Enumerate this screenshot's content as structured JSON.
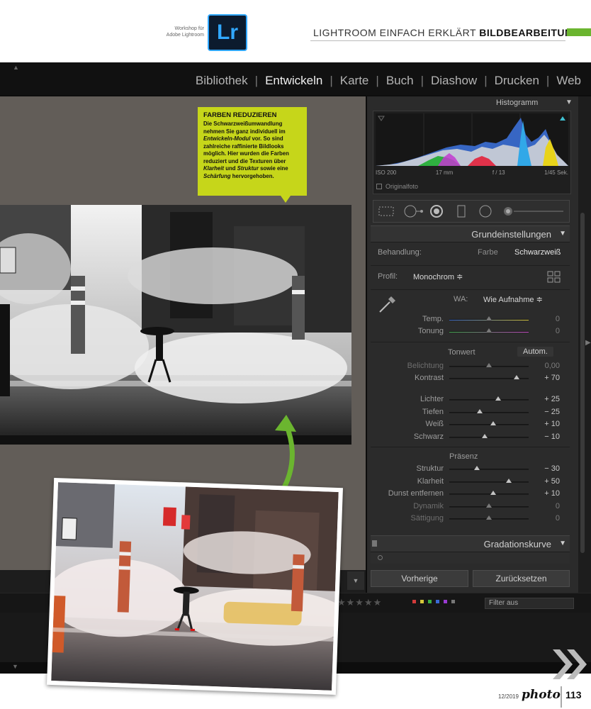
{
  "magazine": {
    "workshop_line1": "Workshop für",
    "workshop_line2": "Adobe Lightroom",
    "logo_text": "Lr",
    "header_normal": "LIGHTROOM EINFACH ERKLÄRT",
    "header_bold": "BILDBEARBEITUNG",
    "footer_issue": "12/2019",
    "footer_brand": "photo",
    "footer_page": "113"
  },
  "modules": {
    "items": [
      "Bibliothek",
      "Entwickeln",
      "Karte",
      "Buch",
      "Diashow",
      "Drucken",
      "Web"
    ],
    "active": "Entwickeln"
  },
  "histogram": {
    "title": "Histogramm",
    "iso": "ISO 200",
    "focal": "17 mm",
    "aperture": "f / 13",
    "shutter": "1/45 Sek.",
    "original_photo": "Originalfoto"
  },
  "basic": {
    "title": "Grundeinstellungen",
    "treatment_label": "Behandlung:",
    "treatment_color": "Farbe",
    "treatment_bw": "Schwarzweiß",
    "profile_label": "Profil:",
    "profile_value": "Monochrom ≑",
    "wb_label": "WA:",
    "wb_value": "Wie Aufnahme ≑",
    "temp_label": "Temp.",
    "temp_value": "0",
    "tint_label": "Tonung",
    "tint_value": "0",
    "tone_label": "Tonwert",
    "auto_label": "Autom.",
    "sliders_tone": [
      {
        "label": "Belichtung",
        "value": "0,00",
        "pos": 0.5,
        "dim": true
      },
      {
        "label": "Kontrast",
        "value": "+ 70",
        "pos": 0.85,
        "dim": false
      }
    ],
    "sliders_light": [
      {
        "label": "Lichter",
        "value": "+ 25",
        "pos": 0.62
      },
      {
        "label": "Tiefen",
        "value": "− 25",
        "pos": 0.38
      },
      {
        "label": "Weiß",
        "value": "+ 10",
        "pos": 0.55
      },
      {
        "label": "Schwarz",
        "value": "− 10",
        "pos": 0.45
      }
    ],
    "presence_label": "Präsenz",
    "sliders_presence": [
      {
        "label": "Struktur",
        "value": "− 30",
        "pos": 0.35,
        "dim": false
      },
      {
        "label": "Klarheit",
        "value": "+ 50",
        "pos": 0.75,
        "dim": false
      },
      {
        "label": "Dunst entfernen",
        "value": "+ 10",
        "pos": 0.55,
        "dim": false
      },
      {
        "label": "Dynamik",
        "value": "0",
        "pos": 0.5,
        "dim": true
      },
      {
        "label": "Sättigung",
        "value": "0",
        "pos": 0.5,
        "dim": true
      }
    ]
  },
  "curve": {
    "title": "Gradationskurve"
  },
  "buttons": {
    "previous": "Vorherige",
    "reset": "Zurücksetzen"
  },
  "filmstrip": {
    "filter": "Filter aus"
  },
  "callout": {
    "title": "FARBEN REDUZIEREN",
    "text_1": "Die Schwarzweißumwandlung nehmen Sie ganz individuell im ",
    "text_em1": "Entwickeln-Modul",
    "text_2": " vor. So sind zahlreiche raffinierte Bildlooks möglich. Hier wurden die Farben reduziert und die Texturen über ",
    "text_em2": "Klarheit",
    "text_3": " und ",
    "text_em3": "Struktur",
    "text_4": " sowie eine ",
    "text_em4": "Schärfung",
    "text_5": " hervorgehoben."
  }
}
